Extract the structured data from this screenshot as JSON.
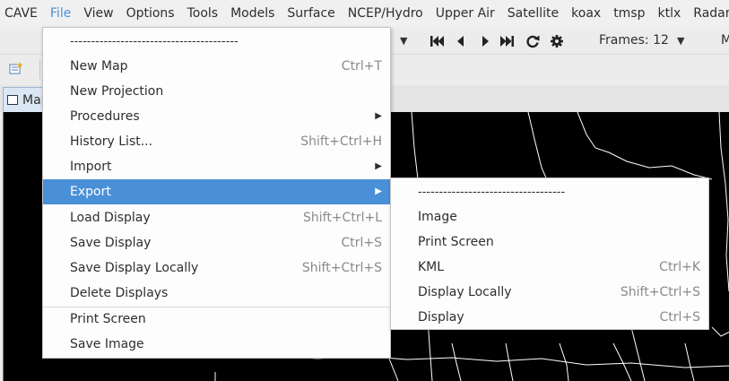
{
  "menubar": {
    "items": [
      "CAVE",
      "File",
      "View",
      "Options",
      "Tools",
      "Models",
      "Surface",
      "NCEP/Hydro",
      "Upper Air",
      "Satellite",
      "koax",
      "tmsp",
      "ktlx",
      "Radar"
    ],
    "active_index": 1
  },
  "toolbar": {
    "frames_label": "Frames: 12",
    "trailing_text": "M"
  },
  "tab": {
    "label": "Map"
  },
  "file_menu": {
    "tearoff": "----------------------------------------",
    "items": [
      {
        "label": "New Map",
        "shortcut": "Ctrl+T"
      },
      {
        "label": "New Projection",
        "shortcut": ""
      },
      {
        "label": "Procedures",
        "shortcut": "",
        "submenu": true
      },
      {
        "label": "History List...",
        "shortcut": "Shift+Ctrl+H"
      },
      {
        "label": "Import",
        "shortcut": "",
        "submenu": true
      },
      {
        "label": "Export",
        "shortcut": "",
        "submenu": true,
        "highlighted": true
      },
      {
        "label": "Load Display",
        "shortcut": "Shift+Ctrl+L"
      },
      {
        "label": "Save Display",
        "shortcut": "Ctrl+S"
      },
      {
        "label": "Save Display Locally",
        "shortcut": "Shift+Ctrl+S"
      },
      {
        "label": "Delete Displays",
        "shortcut": ""
      },
      {
        "label": "Print Screen",
        "shortcut": ""
      },
      {
        "label": "Save Image",
        "shortcut": ""
      }
    ]
  },
  "export_menu": {
    "tearoff": "-----------------------------------",
    "items": [
      {
        "label": "Image",
        "shortcut": ""
      },
      {
        "label": "Print Screen",
        "shortcut": ""
      },
      {
        "label": "KML",
        "shortcut": "Ctrl+K"
      },
      {
        "label": "Display Locally",
        "shortcut": "Shift+Ctrl+S"
      },
      {
        "label": "Display",
        "shortcut": "Ctrl+S"
      }
    ]
  },
  "colors": {
    "accent": "#4a90d9",
    "map_background": "#000000",
    "map_lines": "#ffffff"
  },
  "icons": [
    "first-frame-icon",
    "step-back-icon",
    "step-forward-icon",
    "last-frame-icon",
    "loop-icon",
    "settings-icon",
    "properties-icon"
  ]
}
